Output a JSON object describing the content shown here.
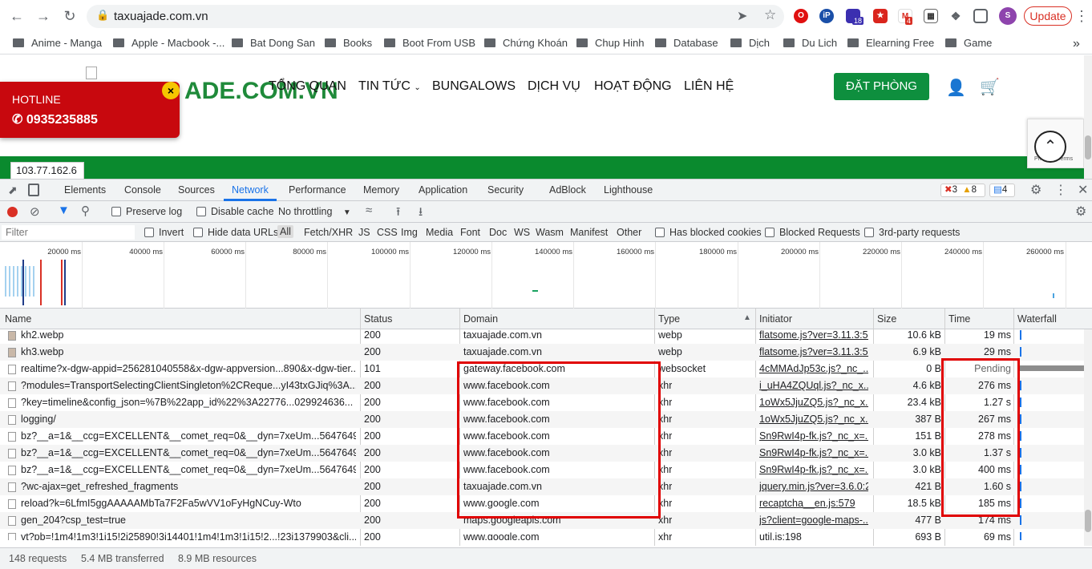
{
  "browser": {
    "url": "taxuajade.com.vn",
    "update_label": "Update",
    "ext_badges": {
      "a": "18",
      "b": "4"
    },
    "profile_initial": "S"
  },
  "bookmarks": [
    "Anime - Manga",
    "Apple - Macbook -...",
    "Bat Dong San",
    "Books",
    "Boot From USB",
    "Chứng Khoán",
    "Chup Hinh",
    "Database",
    "Dịch",
    "Du Lich",
    "Elearning Free",
    "Game"
  ],
  "site": {
    "logo_text": "ADE.COM.VN",
    "menu": [
      "TỔNG QUAN",
      "TIN TỨC",
      "BUNGALOWS",
      "DỊCH VỤ",
      "HOẠT ĐỘNG",
      "LIÊN HỆ"
    ],
    "book_button": "ĐẶT PHÒNG",
    "hotline_title": "HOTLINE",
    "hotline_number": "0935235885",
    "ip": "103.77.162.6",
    "recaptcha_links": "Privacy - Terms"
  },
  "devtools": {
    "tabs": [
      "Elements",
      "Console",
      "Sources",
      "Network",
      "Performance",
      "Memory",
      "Application",
      "Security",
      "AdBlock",
      "Lighthouse"
    ],
    "active_tab": "Network",
    "counts": {
      "errors": "3",
      "warnings": "8",
      "messages": "4"
    },
    "toolbar": {
      "preserve_log": "Preserve log",
      "disable_cache": "Disable cache",
      "throttling": "No throttling"
    },
    "filter": {
      "placeholder": "Filter",
      "invert": "Invert",
      "hide_data_urls": "Hide data URLs",
      "types": [
        "All",
        "Fetch/XHR",
        "JS",
        "CSS",
        "Img",
        "Media",
        "Font",
        "Doc",
        "WS",
        "Wasm",
        "Manifest",
        "Other"
      ],
      "has_blocked_cookies": "Has blocked cookies",
      "blocked_requests": "Blocked Requests",
      "third_party": "3rd-party requests"
    },
    "overview_ticks": [
      "20000 ms",
      "40000 ms",
      "60000 ms",
      "80000 ms",
      "100000 ms",
      "120000 ms",
      "140000 ms",
      "160000 ms",
      "180000 ms",
      "200000 ms",
      "220000 ms",
      "240000 ms",
      "260000 ms"
    ],
    "columns": [
      "Name",
      "Status",
      "Domain",
      "Type",
      "Initiator",
      "Size",
      "Time",
      "Waterfall"
    ],
    "rows": [
      {
        "name": "kh2.webp",
        "status": "200",
        "domain": "taxuajade.com.vn",
        "type": "webp",
        "initiator": "flatsome.js?ver=3.11.3:51",
        "size": "10.6 kB",
        "time": "19 ms"
      },
      {
        "name": "kh3.webp",
        "status": "200",
        "domain": "taxuajade.com.vn",
        "type": "webp",
        "initiator": "flatsome.js?ver=3.11.3:51",
        "size": "6.9 kB",
        "time": "29 ms"
      },
      {
        "name": "realtime?x-dgw-appid=256281040558&x-dgw-appversion...890&x-dgw-tier...",
        "status": "101",
        "domain": "gateway.facebook.com",
        "type": "websocket",
        "initiator": "4cMMAdJp53c.js?_nc_...",
        "size": "0 B",
        "time": "Pending"
      },
      {
        "name": "?modules=TransportSelectingClientSingleton%2CReque...yI43txGJiq%3A...",
        "status": "200",
        "domain": "www.facebook.com",
        "type": "xhr",
        "initiator": "i_uHA4ZQUql.js?_nc_x...",
        "size": "4.6 kB",
        "time": "276 ms"
      },
      {
        "name": "?key=timeline&config_json=%7B%22app_id%22%3A22776...029924636...",
        "status": "200",
        "domain": "www.facebook.com",
        "type": "xhr",
        "initiator": "1oWx5JjuZQ5.js?_nc_x...",
        "size": "23.4 kB",
        "time": "1.27 s"
      },
      {
        "name": "logging/",
        "status": "200",
        "domain": "www.facebook.com",
        "type": "xhr",
        "initiator": "1oWx5JjuZQ5.js?_nc_x...",
        "size": "387 B",
        "time": "267 ms"
      },
      {
        "name": "bz?__a=1&__ccg=EXCELLENT&__comet_req=0&__dyn=7xeUm...56476492...",
        "status": "200",
        "domain": "www.facebook.com",
        "type": "xhr",
        "initiator": "Sn9RwI4p-fk.js?_nc_x=...",
        "size": "151 B",
        "time": "278 ms"
      },
      {
        "name": "bz?__a=1&__ccg=EXCELLENT&__comet_req=0&__dyn=7xeUm...56476492...",
        "status": "200",
        "domain": "www.facebook.com",
        "type": "xhr",
        "initiator": "Sn9RwI4p-fk.js?_nc_x=...",
        "size": "3.0 kB",
        "time": "1.37 s"
      },
      {
        "name": "bz?__a=1&__ccg=EXCELLENT&__comet_req=0&__dyn=7xeUm...56476492...",
        "status": "200",
        "domain": "www.facebook.com",
        "type": "xhr",
        "initiator": "Sn9RwI4p-fk.js?_nc_x=...",
        "size": "3.0 kB",
        "time": "400 ms"
      },
      {
        "name": "?wc-ajax=get_refreshed_fragments",
        "status": "200",
        "domain": "taxuajade.com.vn",
        "type": "xhr",
        "initiator": "jquery.min.js?ver=3.6.0:2",
        "size": "421 B",
        "time": "1.60 s"
      },
      {
        "name": "reload?k=6LfmI5ggAAAAAMbTa7F2Fa5wVV1oFyHgNCuy-Wto",
        "status": "200",
        "domain": "www.google.com",
        "type": "xhr",
        "initiator": "recaptcha__en.js:579",
        "size": "18.5 kB",
        "time": "185 ms"
      },
      {
        "name": "gen_204?csp_test=true",
        "status": "200",
        "domain": "maps.googleapis.com",
        "type": "xhr",
        "initiator": "js?client=google-maps-...",
        "size": "477 B",
        "time": "174 ms"
      },
      {
        "name": "vt?pb=!1m4!1m3!1i15!2i25890!3i14401!1m4!1m3!1i15!2...!23i1379903&cli...",
        "status": "200",
        "domain": "www.google.com",
        "type": "xhr",
        "initiator": "util.js:198",
        "size": "693 B",
        "time": "69 ms"
      }
    ],
    "status": {
      "requests": "148 requests",
      "transferred": "5.4 MB transferred",
      "resources": "8.9 MB resources"
    }
  },
  "colors": {
    "accent": "#1a73e8",
    "site_green": "#0a8a2e",
    "hotline_red": "#c8080e",
    "highlight": "#e00000"
  }
}
